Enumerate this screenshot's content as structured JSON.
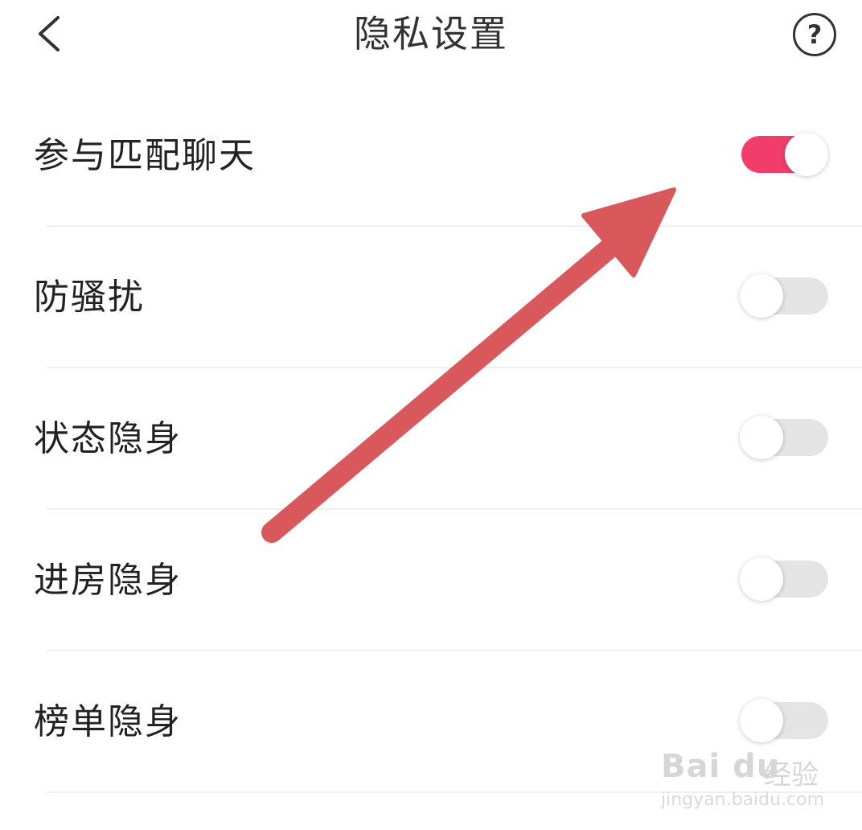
{
  "header": {
    "back_icon": "chevron-left-icon",
    "title": "隐私设置",
    "help_icon": "question-circle-icon",
    "help_glyph": "?"
  },
  "settings": [
    {
      "label": "参与匹配聊天",
      "enabled": true
    },
    {
      "label": "防骚扰",
      "enabled": false
    },
    {
      "label": "状态隐身",
      "enabled": false
    },
    {
      "label": "进房隐身",
      "enabled": false
    },
    {
      "label": "榜单隐身",
      "enabled": false
    }
  ],
  "colors": {
    "toggle_on": "#f23c6a",
    "toggle_off": "#e4e4e4",
    "annotation_arrow": "#d9585c"
  },
  "watermark": {
    "logo": "Bai du",
    "brand": "经验",
    "url": "jingyan.baidu.com"
  }
}
